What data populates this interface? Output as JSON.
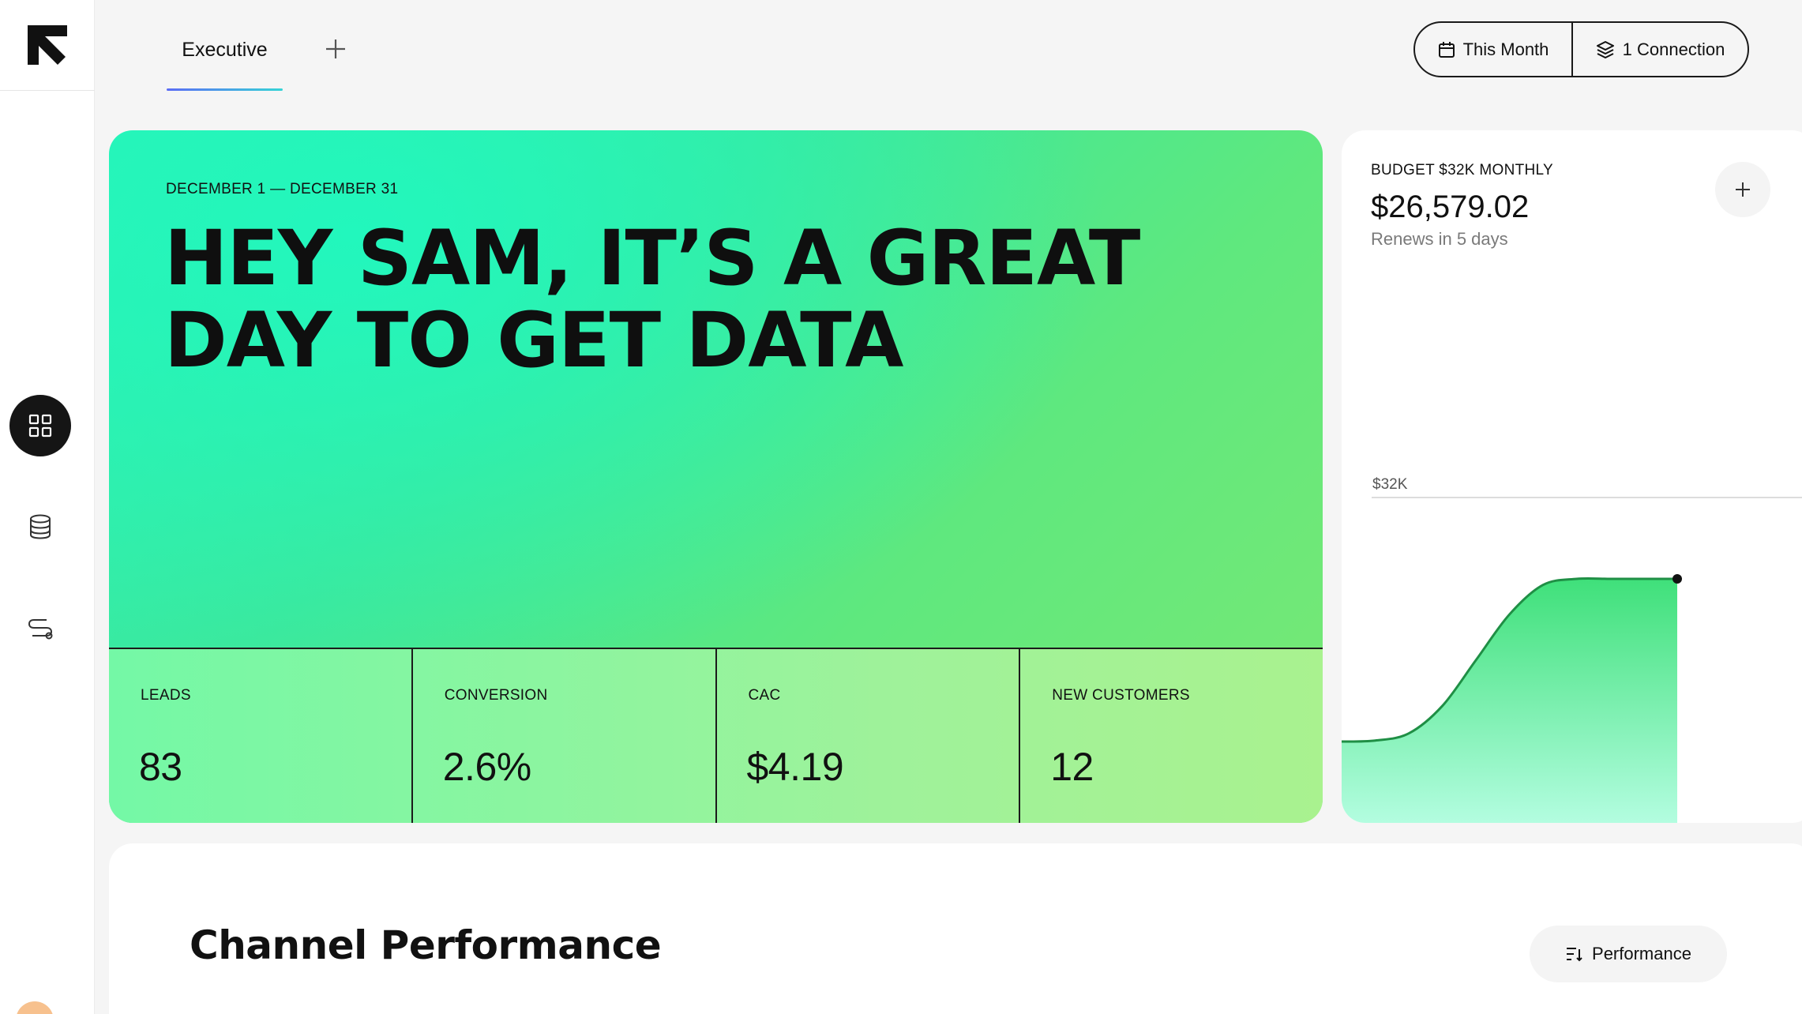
{
  "header": {
    "tabs": [
      {
        "label": "Executive",
        "active": true
      }
    ],
    "add_tab_icon": "plus-icon",
    "date_filter": {
      "label": "This Month",
      "icon": "calendar-icon"
    },
    "connection_filter": {
      "label": "1 Connection",
      "icon": "layers-icon"
    },
    "accent_gradient": [
      "#5b6cf5",
      "#36d4d6"
    ]
  },
  "sidebar": {
    "logo": "brand-logo",
    "items": [
      {
        "icon": "dashboard-grid-icon",
        "active": true
      },
      {
        "icon": "database-icon",
        "active": false
      },
      {
        "icon": "route-icon",
        "active": false
      }
    ]
  },
  "hero": {
    "date_range": "DECEMBER 1 — DECEMBER 31",
    "greeting": "HEY SAM, IT’S A GREAT DAY TO GET DATA",
    "stats": [
      {
        "label": "LEADS",
        "value": "83"
      },
      {
        "label": "CONVERSION",
        "value": "2.6%"
      },
      {
        "label": "CAC",
        "value": "$4.19"
      },
      {
        "label": "NEW CUSTOMERS",
        "value": "12"
      }
    ],
    "colors": {
      "start": "#2af2b6",
      "end": "#7ae874"
    }
  },
  "budget": {
    "label": "BUDGET $32K MONTHLY",
    "amount": "$26,579.02",
    "renewal": "Renews in 5 days",
    "add_icon": "plus-icon",
    "chart_data": {
      "type": "area",
      "ylabel_reference": "$32K",
      "reference_value": 32000,
      "x": [
        0,
        0.1,
        0.2,
        0.3,
        0.4,
        0.5,
        0.6,
        0.7,
        0.8,
        0.9,
        1.0
      ],
      "values": [
        8000,
        8100,
        8800,
        11500,
        16000,
        20500,
        23400,
        24000,
        24000,
        24000,
        24000
      ],
      "ylim": [
        0,
        32000
      ],
      "color": "#34d26a"
    }
  },
  "channel_performance": {
    "title": "Channel Performance",
    "sort_button": {
      "label": "Performance",
      "icon": "sort-icon"
    }
  }
}
